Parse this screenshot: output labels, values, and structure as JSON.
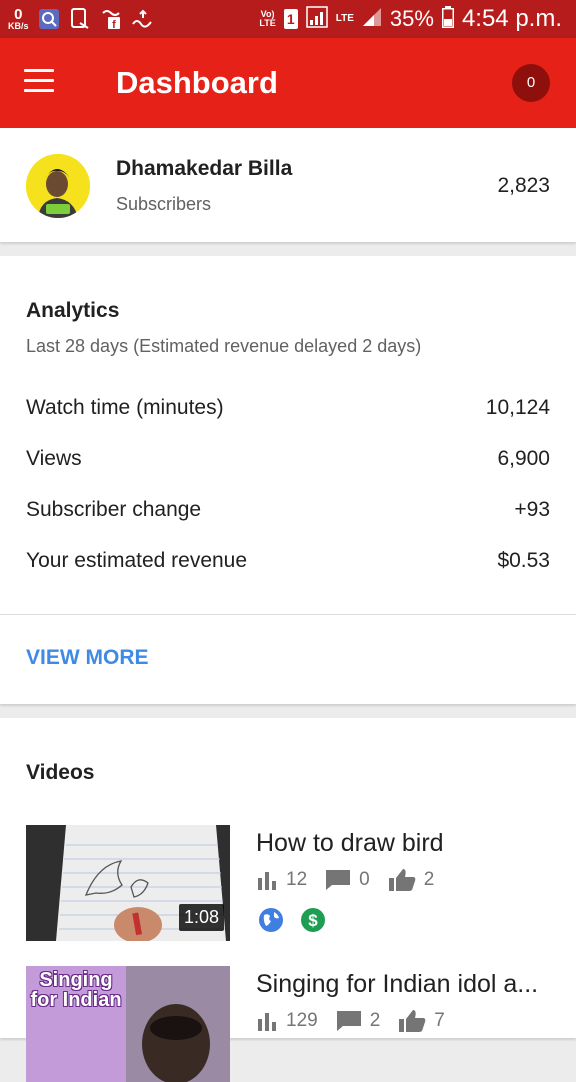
{
  "status_bar": {
    "net_speed_value": "0",
    "net_speed_unit": "KB/s",
    "volte": "Vo)",
    "volte_sub": "LTE",
    "sim_slot": "1",
    "network_type": "LTE",
    "battery": "35%",
    "time": "4:54 p.m."
  },
  "app_bar": {
    "title": "Dashboard",
    "notification_count": "0"
  },
  "channel": {
    "name": "Dhamakedar Billa",
    "subtitle": "Subscribers",
    "subscriber_count": "2,823"
  },
  "analytics": {
    "title": "Analytics",
    "subtitle": "Last 28 days (Estimated revenue delayed 2 days)",
    "rows": [
      {
        "label": "Watch time (minutes)",
        "value": "10,124"
      },
      {
        "label": "Views",
        "value": "6,900"
      },
      {
        "label": "Subscriber change",
        "value": "+93"
      },
      {
        "label": "Your estimated revenue",
        "value": "$0.53"
      }
    ],
    "view_more": "VIEW MORE"
  },
  "videos": {
    "title": "Videos",
    "items": [
      {
        "title": "How to draw bird",
        "duration": "1:08",
        "views": "12",
        "comments": "0",
        "likes": "2",
        "thumb_text": ""
      },
      {
        "title": "Singing for Indian idol a...",
        "duration": "",
        "views": "129",
        "comments": "2",
        "likes": "7",
        "thumb_text": "Singing for Indian"
      }
    ]
  },
  "colors": {
    "status_bar": "#b71c1c",
    "app_bar": "#e62117",
    "link": "#3f8ae4",
    "public_badge": "#3f7fe0",
    "monetized_badge": "#1e9e52"
  },
  "icons": [
    "menu-icon",
    "analytics-bars-icon",
    "comment-icon",
    "thumbs-up-icon",
    "globe-icon",
    "dollar-icon"
  ]
}
